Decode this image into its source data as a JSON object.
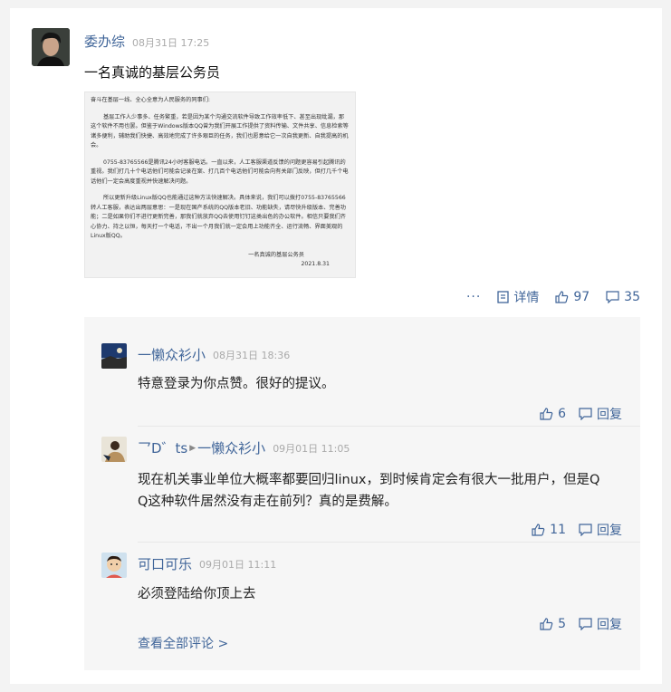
{
  "post": {
    "author": "委办综",
    "time": "08月31日 17:25",
    "text": "一名真诚的基层公务员",
    "letter": {
      "p1": "奋斗在基层一线、全心全意为人民服务的同事们:",
      "p2": "基层工作人少事多、任务繁重，若是因为某个沟通交流软件导致工作效率低下、甚至出现纰漏，那这个软件不用也罢。但鉴于Windows版本QQ曾为我们开展工作提供了资料传输、文件共享、信息检索等诸多便利，辅助我们快捷、高效地完成了许多艰巨的任务，我们也愿意给它一次自我更新、自我提高的机会。",
      "p3": "0755-83765566是腾讯24小时客服电话。一直以来，人工客服渠道反馈的问题更容易引起腾讯的重视。我们打几十个电话他们可能会记录在案、打几百个电话他们可能会向有关部门反映，但打几千个电话他们一定会高度重视并快速解决问题。",
      "p4": "所以更新升级Linux版QQ也能通过这种方法快速解决。具体来说，我们可以拨打0755-83765566转人工客服，表达出两层意思：一是现在国产系统的QQ版本老旧、功能缺失，请尽快升级版本、完善功能；二是如果你们不进行更新完善，那我们就放弃QQ去使用钉钉这类出色的办公软件。相信只要我们齐心协力、持之以恒，每天打一个电话，不出一个月我们就一定会用上功能齐全、运行流畅、界面美观的Linux版QQ。",
      "sign": "一名真诚的基层公务员",
      "date": "2021.8.31"
    },
    "actions": {
      "more": "···",
      "detail": "详情",
      "likes": "97",
      "comments": "35"
    }
  },
  "comments": [
    {
      "author": "一懒众衫小",
      "time": "08月31日 18:36",
      "text": "特意登录为你点赞。很好的提议。",
      "likes": "6",
      "reply": "回复"
    },
    {
      "author": "乛D゛ts",
      "reply_to": "一懒众衫小",
      "time": "09月01日 11:05",
      "text_line1": "现在机关事业单位大概率都要回归linux，到时候肯定会有很大一批用户，但是Q",
      "text_line2": "Q这种软件居然没有走在前列？真的是费解。",
      "likes": "11",
      "reply": "回复"
    },
    {
      "author": "可口可乐",
      "time": "09月01日 11:11",
      "text": "必须登陆给你顶上去",
      "likes": "5",
      "reply": "回复"
    }
  ],
  "view_all": "查看全部评论 >"
}
